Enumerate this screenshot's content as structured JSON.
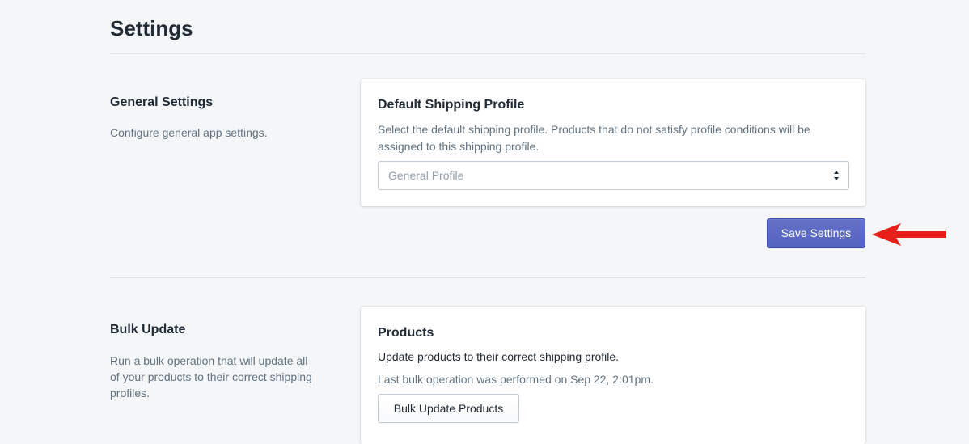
{
  "page": {
    "title": "Settings"
  },
  "general_section": {
    "heading": "General Settings",
    "description": "Configure general app settings.",
    "card": {
      "title": "Default Shipping Profile",
      "help_text": "Select the default shipping profile. Products that do not satisfy profile conditions will be assigned to this shipping profile.",
      "select": {
        "selected_value": "General Profile",
        "icon": "select-arrows-icon"
      }
    },
    "save_button_label": "Save Settings",
    "annotation": {
      "icon": "red-arrow-icon",
      "color": "#e8201a"
    }
  },
  "bulk_section": {
    "heading": "Bulk Update",
    "description": "Run a bulk operation that will update all of your products to their correct shipping profiles.",
    "card": {
      "title": "Products",
      "text": "Update products to their correct shipping profile.",
      "last_operation": "Last bulk operation was performed on Sep 22, 2:01pm.",
      "button_label": "Bulk Update Products"
    }
  },
  "colors": {
    "background": "#f4f6f8",
    "primary": "#5c6ac4",
    "text": "#212b36",
    "subdued": "#637381"
  }
}
